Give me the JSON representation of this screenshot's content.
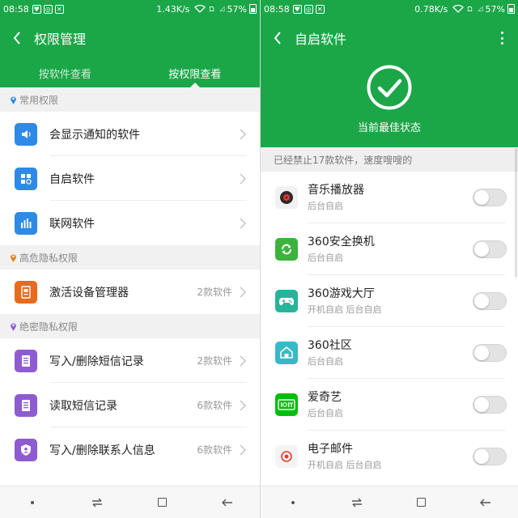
{
  "colors": {
    "brand": "#1ba748",
    "section_bg": "#f1f1f1"
  },
  "left": {
    "status": {
      "time": "08:58",
      "net": "1.43K/s",
      "battery": "57%"
    },
    "title": "权限管理",
    "tabs": [
      {
        "label": "按软件查看",
        "active": false
      },
      {
        "label": "按权限查看",
        "active": true
      }
    ],
    "sections": [
      {
        "header": "常用权限",
        "pin_color": "#2e8ae6",
        "items": [
          {
            "label": "会显示通知的软件",
            "count": "",
            "icon": "speaker-icon",
            "icon_color": "#2e8ae6"
          },
          {
            "label": "自启软件",
            "count": "",
            "icon": "autostart-icon",
            "icon_color": "#2e8ae6"
          },
          {
            "label": "联网软件",
            "count": "",
            "icon": "bars-icon",
            "icon_color": "#2e8ae6"
          }
        ]
      },
      {
        "header": "高危隐私权限",
        "pin_color": "#e8791c",
        "items": [
          {
            "label": "激活设备管理器",
            "count": "2款软件",
            "icon": "device-admin-icon",
            "icon_color": "#e86a1c"
          }
        ]
      },
      {
        "header": "绝密隐私权限",
        "pin_color": "#8f5bd0",
        "items": [
          {
            "label": "写入/删除短信记录",
            "count": "2款软件",
            "icon": "sms-write-icon",
            "icon_color": "#8f5bd0"
          },
          {
            "label": "读取短信记录",
            "count": "6款软件",
            "icon": "sms-read-icon",
            "icon_color": "#8f5bd0"
          },
          {
            "label": "写入/删除联系人信息",
            "count": "6款软件",
            "icon": "contact-shield-icon",
            "icon_color": "#8f5bd0"
          }
        ]
      }
    ]
  },
  "right": {
    "status": {
      "time": "08:58",
      "net": "0.78K/s",
      "battery": "57%"
    },
    "title": "自启软件",
    "state": "当前最佳状态",
    "notice": "已经禁止17款软件，速度嗖嗖的",
    "apps": [
      {
        "name": "音乐播放器",
        "sub": "后台自启",
        "icon": "music-player-icon",
        "enabled": false
      },
      {
        "name": "360安全换机",
        "sub": "后台自启",
        "icon": "phone-switch-icon",
        "enabled": false
      },
      {
        "name": "360游戏大厅",
        "sub": "开机自启 后台自启",
        "icon": "gamepad-icon",
        "enabled": false
      },
      {
        "name": "360社区",
        "sub": "后台自启",
        "icon": "community-icon",
        "enabled": false
      },
      {
        "name": "爱奇艺",
        "sub": "后台自启",
        "icon": "iqiyi-icon",
        "enabled": false
      },
      {
        "name": "电子邮件",
        "sub": "开机自启 后台自启",
        "icon": "email-icon",
        "enabled": false
      }
    ]
  }
}
